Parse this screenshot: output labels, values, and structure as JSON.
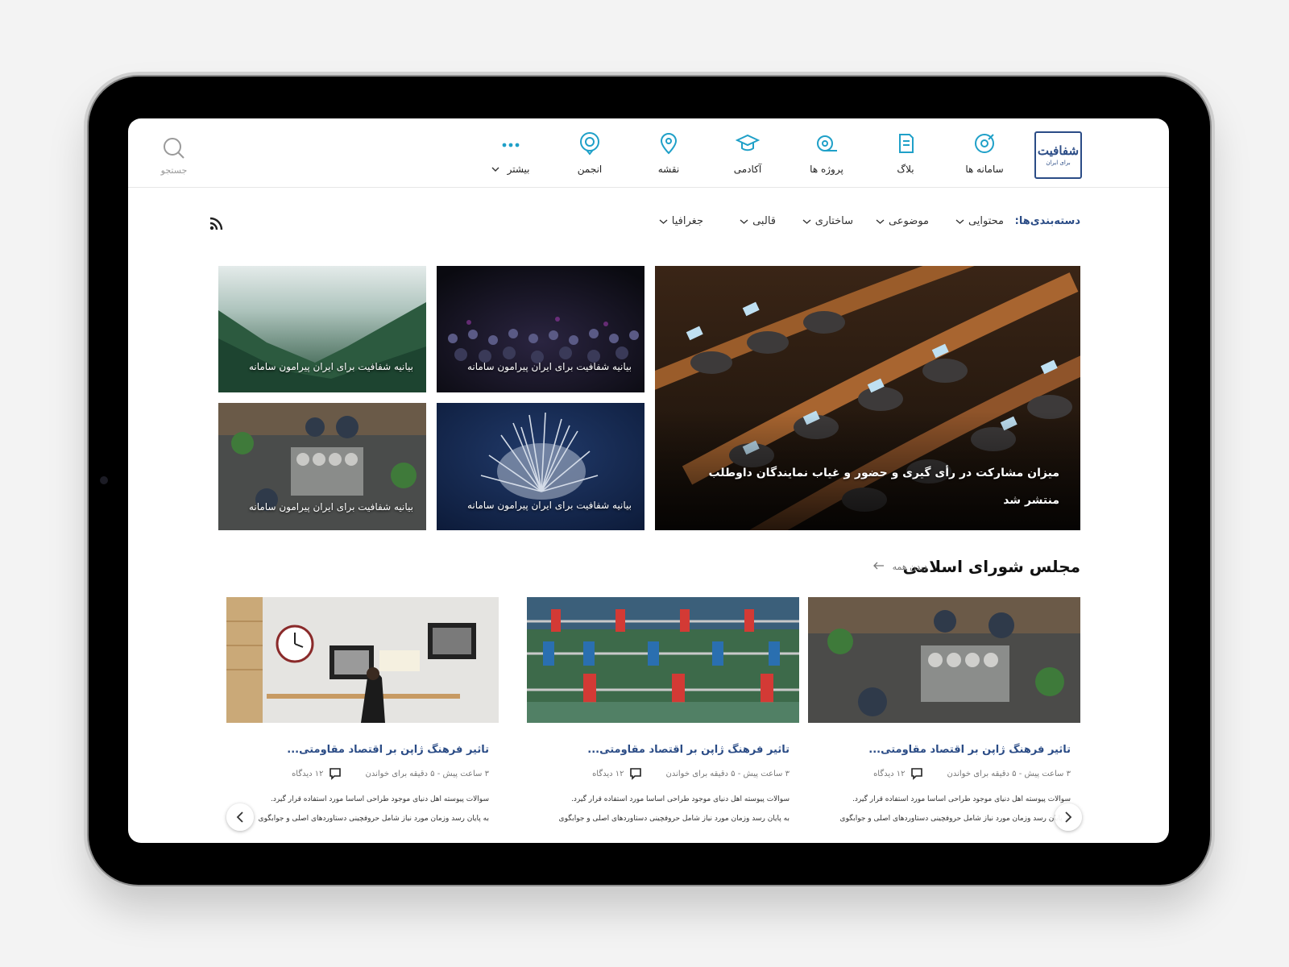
{
  "brand": {
    "logo_main": "شفافیت",
    "logo_sub": "برای ایران"
  },
  "nav": {
    "items": [
      {
        "label": "سامانه ها",
        "icon": "target-icon"
      },
      {
        "label": "بلاگ",
        "icon": "document-icon"
      },
      {
        "label": "پروژه ها",
        "icon": "tape-measure-icon"
      },
      {
        "label": "آکادمی",
        "icon": "graduation-cap-icon"
      },
      {
        "label": "نقشه",
        "icon": "map-pin-icon"
      },
      {
        "label": "انجمن",
        "icon": "chat-pin-icon"
      },
      {
        "label": "بیشتر",
        "icon": "more-dots-icon"
      }
    ],
    "search_label": "جستجو"
  },
  "categories": {
    "title": "دسته‌بندی‌ها:",
    "items": [
      "محتوایی",
      "موضوعی",
      "ساختاری",
      "قالبی",
      "جغرافیا"
    ]
  },
  "featured": {
    "main": {
      "line1": "میزان مشارکت در رأی گیری و حضور و غیاب نمایندگان داوطلب",
      "line2": "منتشر شد"
    },
    "tiles": [
      {
        "caption": "بیانیه شفافیت برای ایران پیرامون سامانه"
      },
      {
        "caption": "بیانیه شفافیت برای ایران پیرامون سامانه"
      },
      {
        "caption": "بیانیه شفافیت برای ایران پیرامون سامانه"
      },
      {
        "caption": "بیانیه شفافیت برای ایران پیرامون سامانه"
      }
    ]
  },
  "section": {
    "title": "مجلس شورای اسلامی",
    "see_all": "دیدن همه"
  },
  "cards": [
    {
      "title": "تاثیر فرهنگ ژاپن بر اقتصاد مقاومتی...",
      "meta": "۳ ساعت پیش - ۵ دقیقه برای خواندن",
      "views": "۱۲ دیدگاه",
      "ex1": "سوالات پیوسته اهل دنیای موجود طراحی اساسا مورد استفاده قرار گیرد.",
      "ex2": "به پایان رسد وزمان مورد نیاز شامل حروفچینی دستاوردهای اصلی و جوابگوی"
    },
    {
      "title": "تاثیر فرهنگ ژاپن بر اقتصاد مقاومتی...",
      "meta": "۳ ساعت پیش - ۵ دقیقه برای خواندن",
      "views": "۱۲ دیدگاه",
      "ex1": "سوالات پیوسته اهل دنیای موجود طراحی اساسا مورد استفاده قرار گیرد.",
      "ex2": "به پایان رسد وزمان مورد نیاز شامل حروفچینی دستاوردهای اصلی و جوابگوی"
    },
    {
      "title": "تاثیر فرهنگ ژاپن بر اقتصاد مقاومتی...",
      "meta": "۳ ساعت پیش - ۵ دقیقه برای خواندن",
      "views": "۱۲ دیدگاه",
      "ex1": "سوالات پیوسته اهل دنیای موجود طراحی اساسا مورد استفاده قرار گیرد.",
      "ex2": "به پایان رسد وزمان مورد نیاز شامل حروفچینی دستاوردهای اصلی و جوابگوی"
    }
  ],
  "colors": {
    "accent": "#2b4c86",
    "icon": "#1fa0c8",
    "dots": "#1fa0c8"
  }
}
